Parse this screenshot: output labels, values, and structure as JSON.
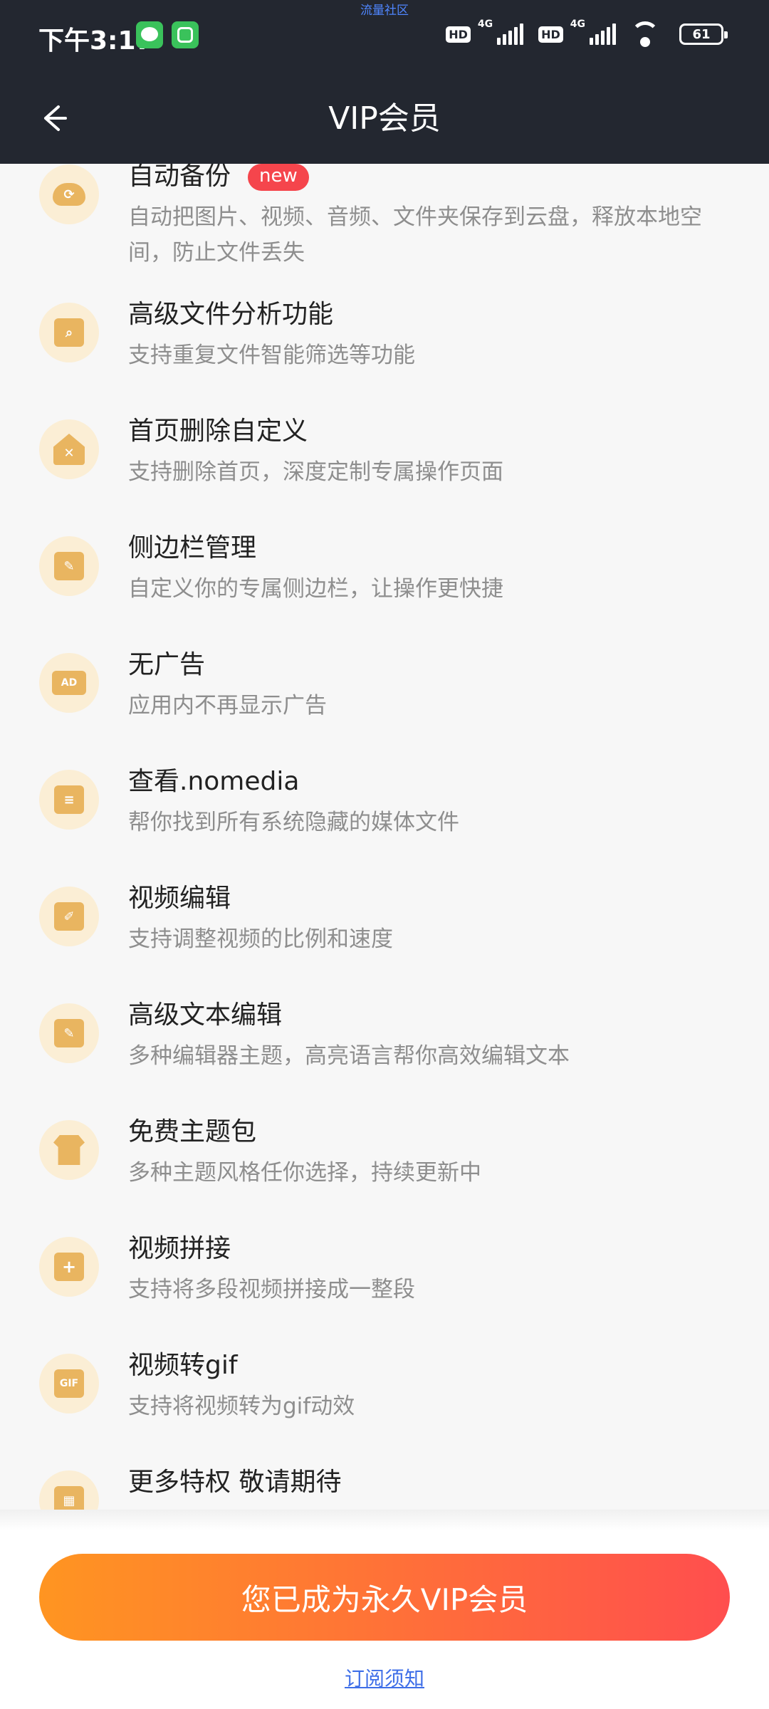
{
  "status_bar": {
    "time": "下午3:17",
    "community_label": "流量社区",
    "hd1": "HD",
    "net1": "4G",
    "hd2": "HD",
    "net2": "4G",
    "battery": "61"
  },
  "app_bar": {
    "title": "VIP会员",
    "back_icon": "arrow-left-icon"
  },
  "features": [
    {
      "icon": "cloud-sync-icon",
      "title": "自动备份",
      "badge": "new",
      "desc": "自动把图片、视频、音频、文件夹保存到云盘，释放本地空间，防止文件丢失"
    },
    {
      "icon": "file-search-icon",
      "title": "高级文件分析功能",
      "desc": "支持重复文件智能筛选等功能"
    },
    {
      "icon": "home-delete-icon",
      "title": "首页删除自定义",
      "desc": "支持删除首页，深度定制专属操作页面"
    },
    {
      "icon": "sidebar-edit-icon",
      "title": "侧边栏管理",
      "desc": "自定义你的专属侧边栏，让操作更快捷"
    },
    {
      "icon": "no-ad-icon",
      "title": "无广告",
      "desc": "应用内不再显示广告"
    },
    {
      "icon": "nomedia-search-icon",
      "title": "查看.nomedia",
      "desc": "帮你找到所有系统隐藏的媒体文件"
    },
    {
      "icon": "video-edit-icon",
      "title": "视频编辑",
      "desc": "支持调整视频的比例和速度"
    },
    {
      "icon": "text-edit-icon",
      "title": "高级文本编辑",
      "desc": "多种编辑器主题，高亮语言帮你高效编辑文本"
    },
    {
      "icon": "tshirt-icon",
      "title": "免费主题包",
      "desc": "多种主题风格任你选择，持续更新中"
    },
    {
      "icon": "video-merge-icon",
      "title": "视频拼接",
      "desc": "支持将多段视频拼接成一整段"
    },
    {
      "icon": "gif-icon",
      "title": "视频转gif",
      "desc": "支持将视频转为gif动效"
    },
    {
      "icon": "grid-icon",
      "title": "更多特权 敬请期待",
      "desc": ""
    }
  ],
  "footer": {
    "button_label": "您已成为永久VIP会员",
    "notice_link": "订阅须知"
  }
}
